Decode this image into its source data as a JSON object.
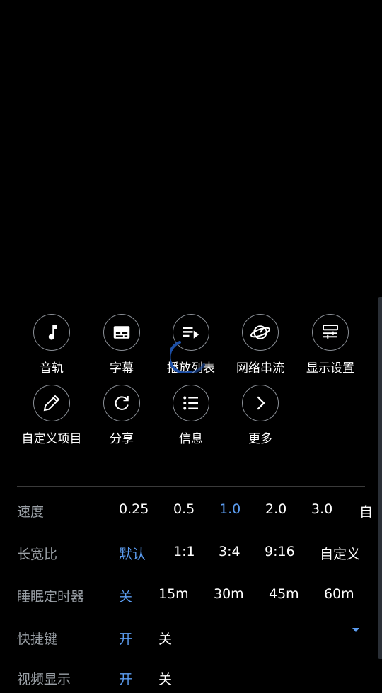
{
  "menu": {
    "buttons": [
      {
        "label": "音轨",
        "icon": "music-note-icon"
      },
      {
        "label": "字幕",
        "icon": "subtitles-icon"
      },
      {
        "label": "播放列表",
        "icon": "playlist-icon"
      },
      {
        "label": "网络串流",
        "icon": "network-stream-icon"
      },
      {
        "label": "显示设置",
        "icon": "display-settings-icon"
      },
      {
        "label": "自定义项目",
        "icon": "pencil-icon"
      },
      {
        "label": "分享",
        "icon": "share-icon"
      },
      {
        "label": "信息",
        "icon": "info-list-icon"
      },
      {
        "label": "更多",
        "icon": "chevron-right-icon"
      }
    ]
  },
  "settings": {
    "speed": {
      "label": "速度",
      "options": [
        "0.25",
        "0.5",
        "1.0",
        "2.0",
        "3.0",
        "自"
      ],
      "selected": "1.0"
    },
    "aspect": {
      "label": "长宽比",
      "options": [
        "默认",
        "1:1",
        "3:4",
        "9:16",
        "自定义"
      ],
      "selected": "默认"
    },
    "sleep": {
      "label": "睡眠定时器",
      "options": [
        "关",
        "15m",
        "30m",
        "45m",
        "60m"
      ],
      "selected": "关"
    },
    "hotkey": {
      "label": "快捷键",
      "options": [
        "开",
        "关"
      ],
      "selected": "开"
    },
    "video_display": {
      "label": "视频显示",
      "options": [
        "开",
        "关"
      ],
      "selected": "开"
    }
  },
  "colors": {
    "accent": "#5b9cf0",
    "label": "#9aa0a6",
    "background": "#000000"
  }
}
